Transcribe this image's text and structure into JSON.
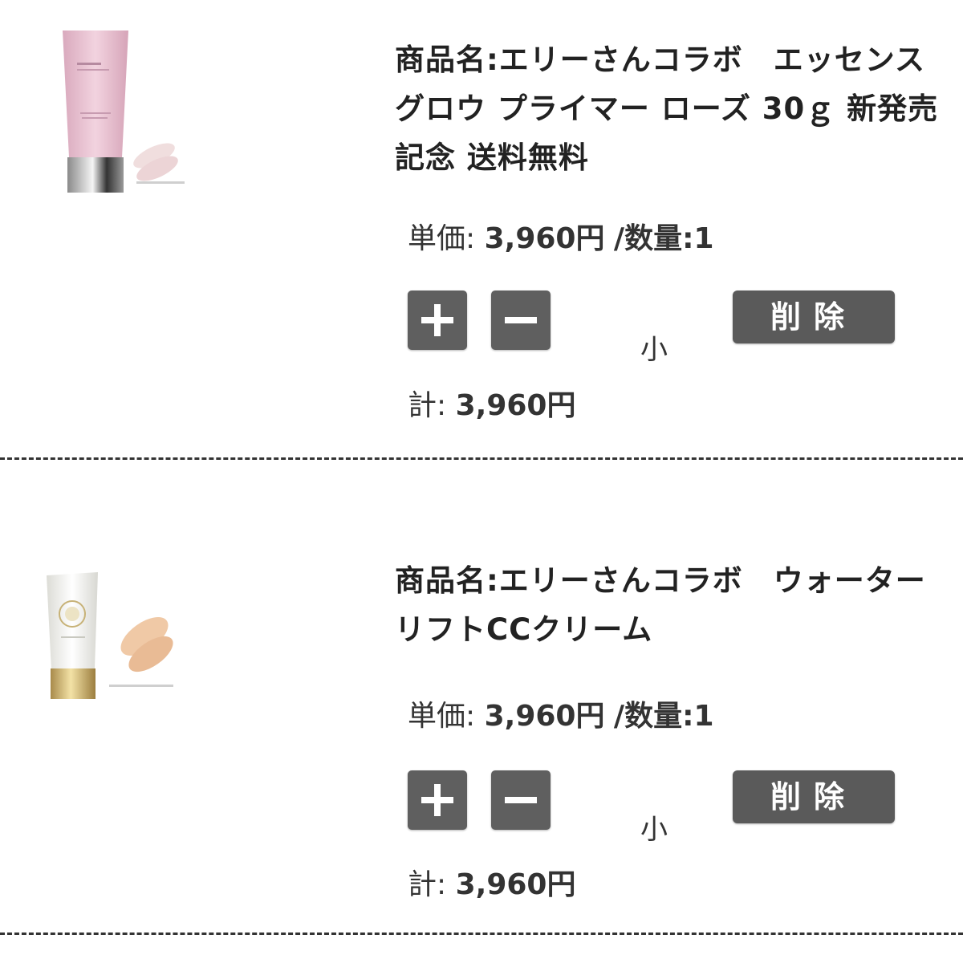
{
  "items": [
    {
      "name": "商品名:エリーさんコラボ　エッセンス グロウ プライマー ローズ 30ｇ 新発売記念 送料無料",
      "unit_price_label": "単価:",
      "unit_price": "3,960円",
      "quantity_label": "/数量:1",
      "plus_icon": "plus-icon",
      "minus_icon": "minus-icon",
      "size": "小",
      "delete_label": "削除",
      "subtotal_label": "計:",
      "subtotal": "3,960円",
      "image_color": "#e7c3d2"
    },
    {
      "name": "商品名:エリーさんコラボ　ウォーターリフトCCクリーム",
      "unit_price_label": "単価:",
      "unit_price": "3,960円",
      "quantity_label": "/数量:1",
      "plus_icon": "plus-icon",
      "minus_icon": "minus-icon",
      "size": "小",
      "delete_label": "削除",
      "subtotal_label": "計:",
      "subtotal": "3,960円",
      "image_color": "#f2f2ee"
    }
  ]
}
